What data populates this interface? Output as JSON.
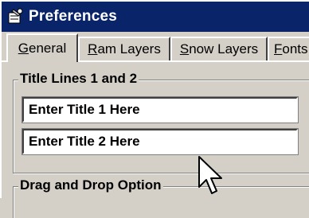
{
  "window": {
    "title": "Preferences",
    "title_icon": "preferences-icon"
  },
  "tabs": [
    {
      "label_pre": "",
      "label_u": "G",
      "label_post": "eneral",
      "active": true
    },
    {
      "label_pre": "",
      "label_u": "R",
      "label_post": "am Layers",
      "active": false
    },
    {
      "label_pre": "",
      "label_u": "S",
      "label_post": "now Layers",
      "active": false
    },
    {
      "label_pre": "",
      "label_u": "F",
      "label_post": "onts",
      "active": false
    }
  ],
  "groups": {
    "title_lines": {
      "label": "Title Lines 1 and 2",
      "title1_value": "Enter Title 1 Here",
      "title2_value": "Enter Title 2 Here"
    },
    "drag_drop": {
      "label": "Drag and Drop Option"
    }
  },
  "colors": {
    "titlebar": "#0a246a",
    "face": "#d4d0c8"
  }
}
